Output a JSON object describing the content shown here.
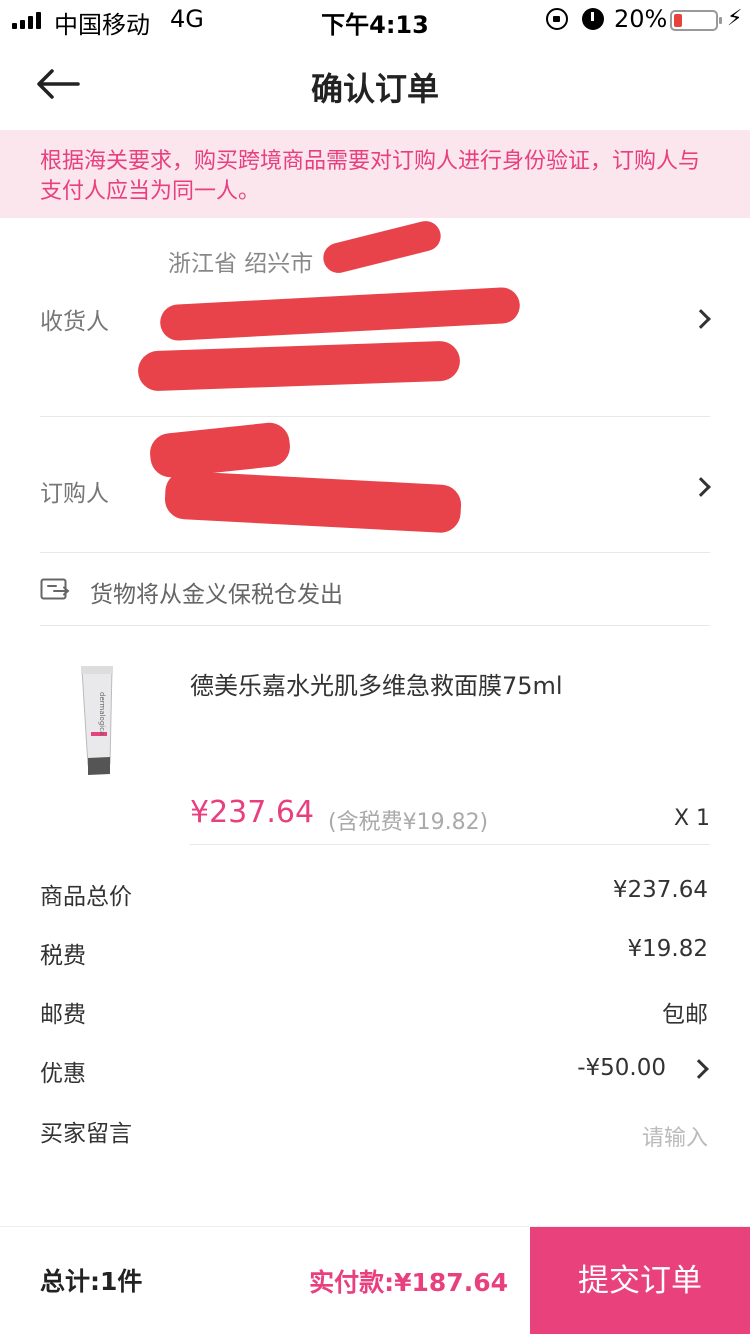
{
  "status_bar": {
    "carrier": "中国移动",
    "network": "4G",
    "time": "下午4:13",
    "battery_percent": "20%",
    "battery_level": 0.2,
    "icons": [
      "signal-icon",
      "orientation-lock-icon",
      "alarm-icon",
      "battery-icon",
      "charging-icon"
    ]
  },
  "nav": {
    "title": "确认订单",
    "back_icon": "back-arrow-icon"
  },
  "notice": {
    "text": "根据海关要求，购买跨境商品需要对订购人进行身份验证，订购人与支付人应当为同一人。"
  },
  "address": {
    "region": "浙江省 绍兴市",
    "receiver_label": "收货人",
    "buyer_label": "订购人"
  },
  "shipping": {
    "text": "货物将从金义保税仓发出",
    "icon": "warehouse-icon"
  },
  "product": {
    "name": "德美乐嘉水光肌多维急救面膜75ml",
    "price": "¥237.64",
    "tax_note": "(含税费¥19.82)",
    "quantity": "X 1"
  },
  "summary": {
    "goods_total_label": "商品总价",
    "goods_total": "¥237.64",
    "tax_label": "税费",
    "tax": "¥19.82",
    "shipping_label": "邮费",
    "shipping": "包邮",
    "discount_label": "优惠",
    "discount": "-¥50.00",
    "message_label": "买家留言",
    "message_placeholder": "请输入"
  },
  "bottom": {
    "total_count": "总计:1件",
    "pay_amount": "实付款:¥187.64",
    "submit_label": "提交订单"
  },
  "colors": {
    "accent": "#e9417c",
    "notice_bg": "#fbe6ee",
    "redaction": "#e8434b"
  }
}
